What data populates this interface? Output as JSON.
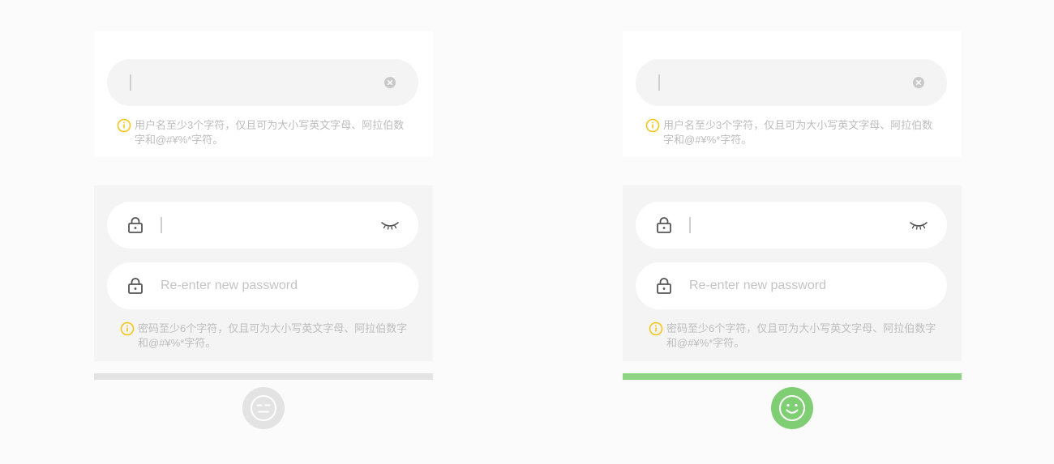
{
  "colors": {
    "hint_icon": "#f5c518",
    "bar_neutral": "#e3e3e3",
    "bar_success": "#8fd485",
    "face_neutral": "#e3e3e3",
    "face_success": "#7fce74"
  },
  "panels": [
    {
      "state": "neutral",
      "username": {
        "value": "",
        "clear_icon": "clear-icon",
        "hint": "用户名至少3个字符，仅且可为大小写英文字母、阿拉伯数字和@#¥%*字符。"
      },
      "password": {
        "value": "",
        "icon": "lock-icon",
        "visibility_icon": "eye-closed-icon"
      },
      "confirm": {
        "value": "",
        "placeholder": "Re-enter new password",
        "icon": "lock-icon"
      },
      "password_hint": "密码至少6个字符，仅且可为大小写英文字母、阿拉伯数字和@#¥%*字符。",
      "strength_face": "neutral-face-icon"
    },
    {
      "state": "success",
      "username": {
        "value": "",
        "clear_icon": "clear-icon",
        "hint": "用户名至少3个字符，仅且可为大小写英文字母、阿拉伯数字和@#¥%*字符。"
      },
      "password": {
        "value": "",
        "icon": "lock-icon",
        "visibility_icon": "eye-closed-icon"
      },
      "confirm": {
        "value": "",
        "placeholder": "Re-enter new password",
        "icon": "lock-icon"
      },
      "password_hint": "密码至少6个字符，仅且可为大小写英文字母、阿拉伯数字和@#¥%*字符。",
      "strength_face": "smile-face-icon"
    }
  ]
}
